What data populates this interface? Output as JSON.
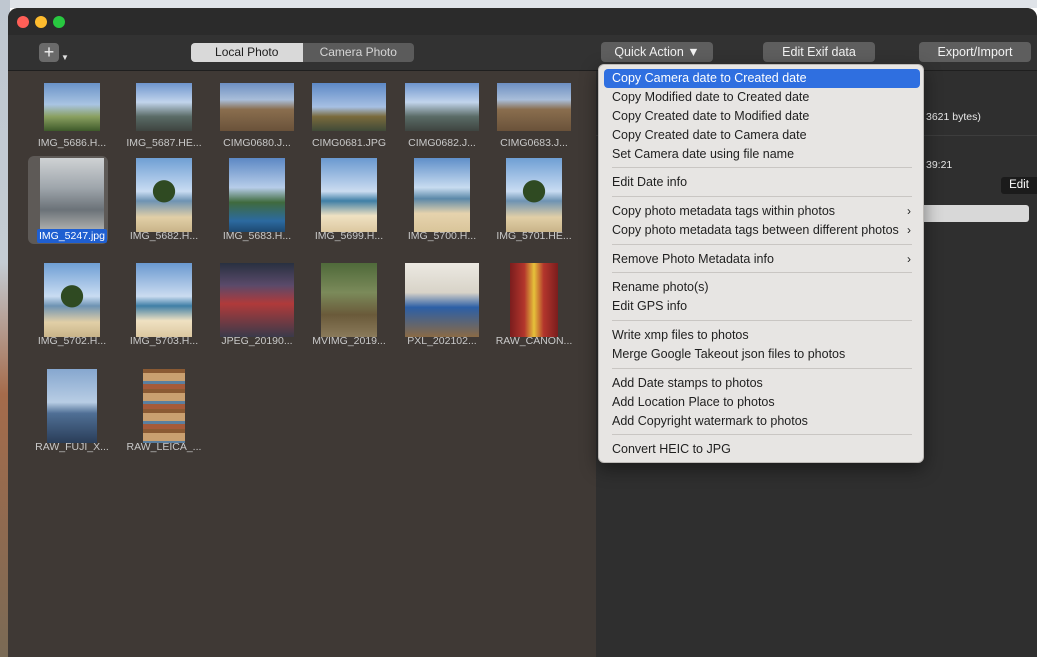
{
  "toolbar": {
    "add_label": "+",
    "segments": [
      "Local Photo",
      "Camera Photo"
    ],
    "quick_action": "Quick Action ▼",
    "edit_exif": "Edit Exif data",
    "export_import": "Export/Import"
  },
  "photos": [
    {
      "name": "IMG_5686.H...",
      "style": "sky"
    },
    {
      "name": "IMG_5687.HE...",
      "style": "building"
    },
    {
      "name": "CIMG0680.J...",
      "style": "ruin"
    },
    {
      "name": "CIMG0681.JPG",
      "style": "temple"
    },
    {
      "name": "CIMG0682.J...",
      "style": "building"
    },
    {
      "name": "CIMG0683.J...",
      "style": "ruin"
    },
    {
      "name": "IMG_5247.jpg",
      "style": "room"
    },
    {
      "name": "IMG_5682.H...",
      "style": "palm"
    },
    {
      "name": "IMG_5683.H...",
      "style": "pool"
    },
    {
      "name": "IMG_5699.H...",
      "style": "sea"
    },
    {
      "name": "IMG_5700.H...",
      "style": "beach"
    },
    {
      "name": "IMG_5701.HE...",
      "style": "palm"
    },
    {
      "name": "IMG_5702.H...",
      "style": "palm"
    },
    {
      "name": "IMG_5703.H...",
      "style": "sea"
    },
    {
      "name": "JPEG_20190...",
      "style": "market"
    },
    {
      "name": "MVIMG_2019...",
      "style": "forest"
    },
    {
      "name": "PXL_202102...",
      "style": "chairs"
    },
    {
      "name": "RAW_CANON...",
      "style": "door"
    },
    {
      "name": "RAW_FUJI_X...",
      "style": "harbor"
    },
    {
      "name": "RAW_LEICA_...",
      "style": "shelf"
    }
  ],
  "info": {
    "size_fragment": "3621 bytes)",
    "time_fragment": "39:21",
    "edit_label": "Edit"
  },
  "menu": {
    "items": [
      {
        "label": "Copy Camera date to Created date",
        "highlight": true,
        "submenu": false
      },
      {
        "label": "Copy Modified date to Created date",
        "submenu": false
      },
      {
        "label": "Copy Created date to Modified date",
        "submenu": false
      },
      {
        "label": "Copy Created date to Camera date",
        "submenu": false
      },
      {
        "label": "Set Camera date using file name",
        "submenu": false
      },
      {
        "label": "Edit Date info",
        "submenu": false
      },
      {
        "label": "Copy photo metadata tags within photos",
        "submenu": true
      },
      {
        "label": "Copy photo metadata tags between different photos",
        "submenu": true
      },
      {
        "label": "Remove Photo Metadata info",
        "submenu": true
      },
      {
        "label": "Rename photo(s)",
        "submenu": false
      },
      {
        "label": "Edit GPS  info",
        "submenu": false
      },
      {
        "label": "Write xmp files to photos",
        "submenu": false
      },
      {
        "label": "Merge Google Takeout json files to photos",
        "submenu": false
      },
      {
        "label": "Add Date stamps to photos",
        "submenu": false
      },
      {
        "label": "Add Location Place to photos",
        "submenu": false
      },
      {
        "label": "Add Copyright watermark to photos",
        "submenu": false
      },
      {
        "label": "Convert HEIC to JPG",
        "submenu": false
      }
    ],
    "submenu_arrow": "›"
  }
}
